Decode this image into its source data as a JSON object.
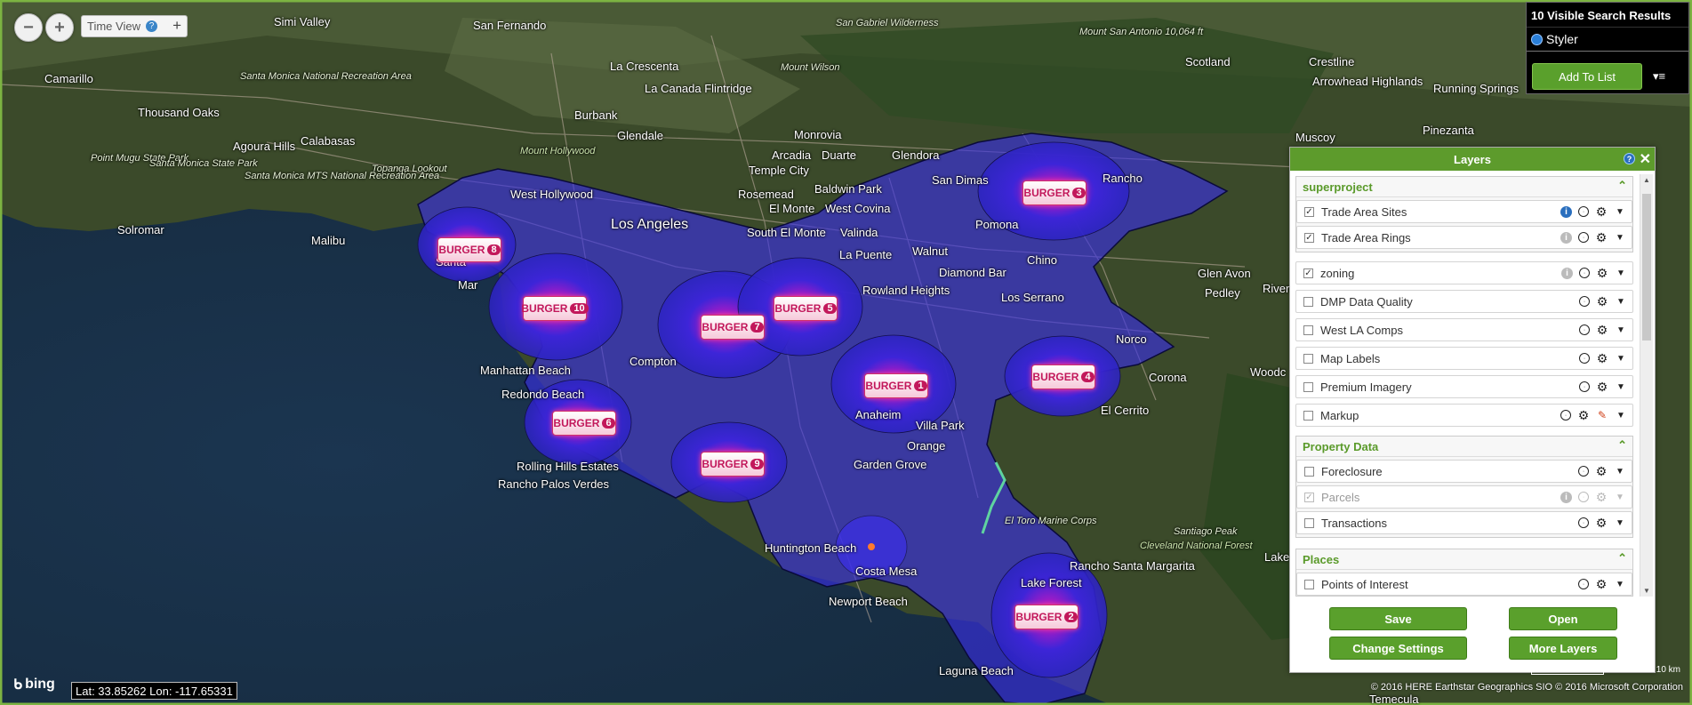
{
  "map": {
    "places": [
      "Simi Valley",
      "San Fernando",
      "San Gabriel Wilderness",
      "Camarillo",
      "La Crescenta",
      "Mount Wilson",
      "Mount San Antonio 10,064 ft",
      "Scotland",
      "Crestline",
      "Arrowhead Highlands",
      "Running Springs",
      "Thousand Oaks",
      "Burbank",
      "La Canada Flintridge",
      "Santa Monica National Recreation Area",
      "Agoura Hills",
      "Calabasas",
      "Glendale",
      "Monrovia",
      "Muscoy",
      "Pinezanta",
      "Point Mugu State Park",
      "Santa Monica State Park",
      "Topanga Lookout",
      "Mount Hollywood",
      "Arcadia",
      "Duarte",
      "Glendora",
      "San Dimas",
      "Rancho",
      "Santa Monica MTS National Recreation Area",
      "Temple City",
      "Rosemead",
      "Baldwin Park",
      "El Monte",
      "West Covina",
      "Solromar",
      "Malibu",
      "Los Angeles",
      "South El Monte",
      "Valinda",
      "Pomona",
      "West Hollywood",
      "La Puente",
      "Walnut",
      "Diamond Bar",
      "Chino",
      "Glen Avon",
      "Pedley",
      "Riverside",
      "Santa",
      "Mar",
      "Rowland Heights",
      "Los Serrano",
      "Manhattan Beach",
      "Compton",
      "Redondo Beach",
      "Norco",
      "Corona",
      "El Cerrito",
      "Woodc",
      "Rolling Hills Estates",
      "Rancho Palos Verdes",
      "Anaheim",
      "Villa Park",
      "Orange",
      "Garden Grove",
      "Santiago Peak",
      "Cleveland National Forest",
      "Huntington Beach",
      "Costa Mesa",
      "El Toro Marine Corps",
      "Rancho Santa Margarita",
      "Newport Beach",
      "Lake Forest",
      "Laguna Beach",
      "Lake",
      "Temecula"
    ],
    "markers": [
      "8",
      "10",
      "7",
      "5",
      "1",
      "4",
      "6",
      "9",
      "3",
      "2"
    ],
    "marker_text": "BURGER"
  },
  "controls": {
    "time_view_label": "Time View",
    "zoom_out": "−",
    "zoom_in": "+",
    "add": "+"
  },
  "results": {
    "title": "10 Visible Search Results",
    "styler_label": "Styler",
    "add_to_list_label": "Add To List",
    "menu_icon": "≡"
  },
  "layers": {
    "title": "Layers",
    "groups": [
      {
        "name": "superproject",
        "items": [
          {
            "label": "Trade Area Sites",
            "checked": true,
            "info": "active"
          },
          {
            "label": "Trade Area Rings",
            "checked": true,
            "info": "grey"
          }
        ]
      }
    ],
    "standalone": [
      {
        "label": "zoning",
        "checked": true,
        "info": "grey"
      },
      {
        "label": "DMP Data Quality",
        "checked": false
      },
      {
        "label": "West LA Comps",
        "checked": false
      },
      {
        "label": "Map Labels",
        "checked": false
      },
      {
        "label": "Premium Imagery",
        "checked": false
      },
      {
        "label": "Markup",
        "checked": false,
        "pencil": true
      }
    ],
    "property_data": {
      "name": "Property Data",
      "items": [
        {
          "label": "Foreclosure",
          "checked": false
        },
        {
          "label": "Parcels",
          "checked": true,
          "disabled": true,
          "info": "grey"
        },
        {
          "label": "Transactions",
          "checked": false
        }
      ]
    },
    "places": {
      "name": "Places",
      "items": [
        {
          "label": "Points of Interest",
          "checked": false
        }
      ]
    },
    "buttons": {
      "save": "Save",
      "open": "Open",
      "change_settings": "Change Settings",
      "more_layers": "More Layers"
    }
  },
  "status": {
    "latlon": "Lat: 33.85262 Lon: -117.65331",
    "bing": "bing",
    "copyright": "© 2016 HERE    Earthstar Geographics SIO    © 2016 Microsoft Corporation",
    "scale_label": "10 km"
  },
  "colors": {
    "accent": "#5d9b2c",
    "trade_area": "#3a2ee8",
    "marker": "#c2185b"
  }
}
